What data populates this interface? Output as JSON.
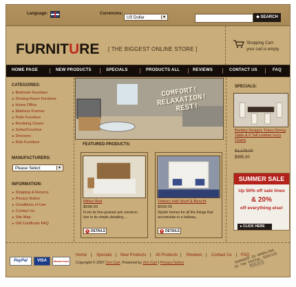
{
  "header": {
    "language_label": "Language:",
    "currencies_label": "Currencies:",
    "currency_value": "US Dollar",
    "search_label": "SEARCH"
  },
  "brand": {
    "logo_part1": "FURNIT",
    "logo_accent": "U",
    "logo_part2": "RE",
    "tagline": "[ THE BIGGEST ONLINE STORE ]"
  },
  "cart": {
    "title": "Shopping Cart:",
    "status": "your cart is empty"
  },
  "nav": [
    "HOME PAGE",
    "NEW PRODUCTS",
    "SPECIALS",
    "PRODUCTS ALL",
    "REVIEWS",
    "CONTACT US",
    "FAQ"
  ],
  "categories": {
    "title": "CATEGORIES:",
    "items": [
      "Bedroom Furniture",
      "Dinning Room Furniture",
      "Home Office",
      "Mattress Frames",
      "Patio Furniture",
      "Reclining Chairs",
      "Sofas/Couches",
      "Dressers",
      "Kids Furniture"
    ]
  },
  "manufacturers": {
    "title": "MANUFACTURERS:",
    "select_value": "Please Select"
  },
  "information": {
    "title": "INFORMATION:",
    "items": [
      "Shipping & Returns",
      "Privacy Notice",
      "Conditions of Use",
      "Contact Us",
      "Site Map",
      "Gift Certificate FAQ"
    ]
  },
  "hero": {
    "line1": "COMFORT!",
    "line2": "RELAXATION!",
    "line3": "REST!"
  },
  "featured": {
    "title": "FEATURED PRODUCTS:",
    "products": [
      {
        "name": "Milton Bed",
        "price": "$698.00",
        "desc_lines": [
          "From its fine-grained ash construc-",
          "tion to its simple detailing,..."
        ],
        "button": "DETAILS"
      },
      {
        "name": "Tetbury Hall Shelf & Bencht",
        "price": "$559.00",
        "desc_lines": [
          "Stylish homes for all the things that",
          "accumulate in a hallway..."
        ],
        "button": "DETAILS"
      }
    ]
  },
  "specials": {
    "title": "SPECIALS:",
    "name": "Bentley Designs Tokyo Dining Table & 6 Tall Leather Ivory Chairs",
    "old_price": "$1,176.00",
    "new_price": "$995.00"
  },
  "sale": {
    "title": "SUMMER SALE",
    "line1": "Up 50% off sale lines",
    "line2": "& 20%",
    "line3": "off everything else!",
    "button": "CLICK HERE"
  },
  "footer": {
    "links": [
      "Home",
      "Specials",
      "New Products",
      "All Products",
      "Reviews",
      "Contact Us",
      "FAQ"
    ],
    "copyright_prefix": "Copyright © 2007",
    "zen_cart": "Zen Cart",
    "powered_by": ". Powered by",
    "zen_cart2": "Zen Cart",
    "privacy": "Privacy Notice",
    "payments": [
      "PayPal",
      "VISA",
      "MasterCard"
    ],
    "stamp_lines": [
      "DAMAGED IN HANDLING",
      "IN THE POSTAL SERVICE"
    ],
    "stamp_word": "MASS"
  }
}
